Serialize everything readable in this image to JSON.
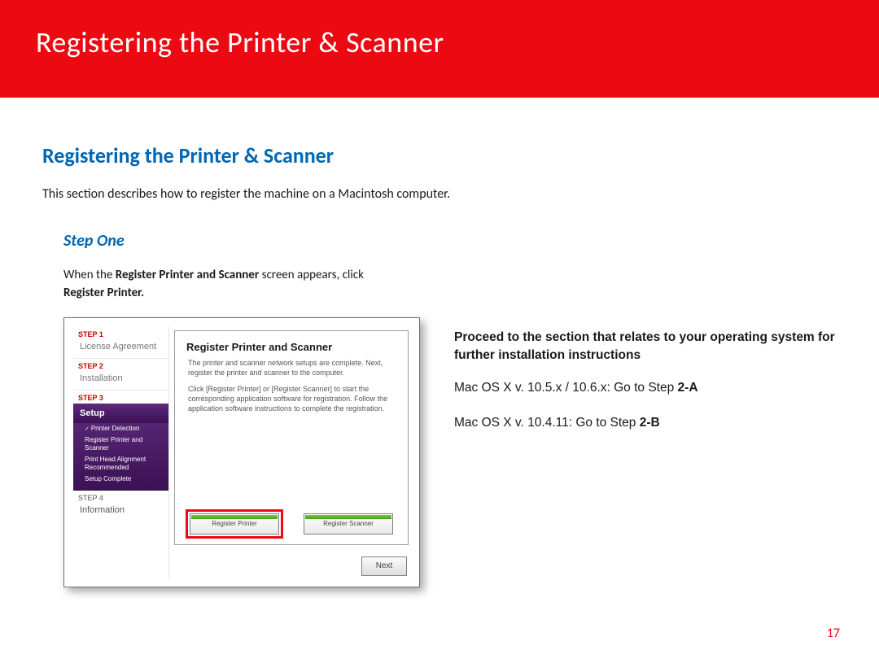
{
  "banner": {
    "title": "Registering the Printer & Scanner"
  },
  "section": {
    "title": "Registering the  Printer & Scanner",
    "desc": "This section describes how to register the machine on a Macintosh computer."
  },
  "step": {
    "heading": "Step One",
    "text_pre": "When the ",
    "text_bold1": "Register Printer and Scanner",
    "text_mid": " screen appears, click ",
    "text_bold2": "Register Printer.",
    "text_post": ""
  },
  "shot": {
    "sidebar": {
      "step1_label": "STEP 1",
      "step1_item": "License Agreement",
      "step2_label": "STEP 2",
      "step2_item": "Installation",
      "step3_label": "STEP 3",
      "setup": "Setup",
      "subs": [
        "Printer Detection",
        "Register Printer and Scanner",
        "Print Head Alignment Recommended",
        "Setup Complete"
      ],
      "step4_label": "STEP 4",
      "step4_item": "Information"
    },
    "main": {
      "title": "Register Printer and Scanner",
      "para1": "The printer and scanner network setups are complete. Next, register the printer and scanner to the computer.",
      "para2": "Click [Register Printer] or [Register Scanner] to start the corresponding application software for registration. Follow the application software instructions to complete the registration.",
      "btn_register_printer": "Register Printer",
      "btn_register_scanner": "Register Scanner",
      "next": "Next"
    }
  },
  "right": {
    "lead": "Proceed to the section that relates to your operating system for further installation instructions",
    "line1_pre": "Mac OS X v. 10.5.x / 10.6.x: Go to Step ",
    "line1_bold": "2-A",
    "line2_pre": "Mac OS X v. 10.4.11: Go to Step ",
    "line2_bold": "2-B"
  },
  "page_number": "17"
}
